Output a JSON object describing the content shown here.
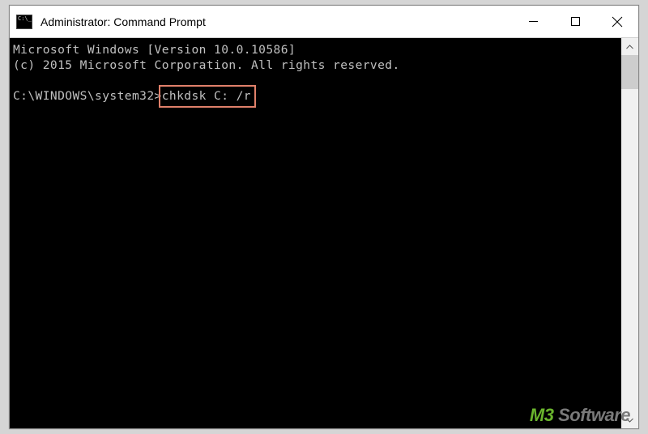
{
  "titlebar": {
    "title": "Administrator: Command Prompt"
  },
  "terminal": {
    "line1": "Microsoft Windows [Version 10.0.10586]",
    "line2": "(c) 2015 Microsoft Corporation. All rights reserved.",
    "prompt": "C:\\WINDOWS\\system32>",
    "command": "chkdsk C: /r"
  },
  "watermark": {
    "part1": "M3",
    "part2": " Software"
  }
}
